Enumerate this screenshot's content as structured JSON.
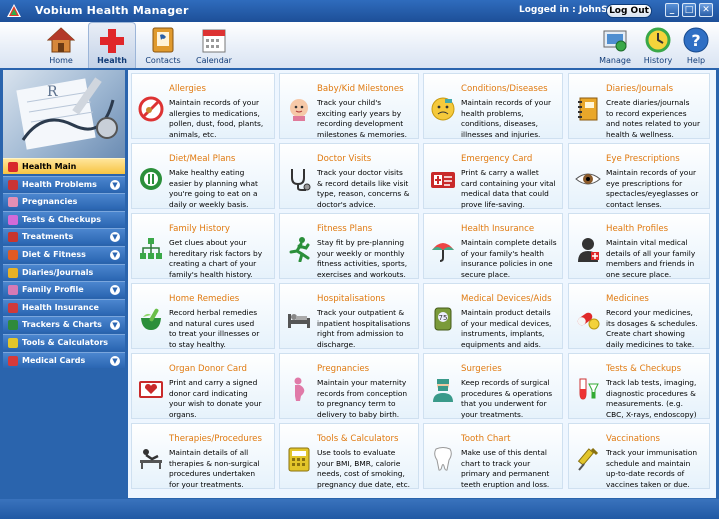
{
  "window": {
    "title": "Vobium Health Manager",
    "logged_in": "Logged in : JohnS",
    "logout": "Log Out",
    "min": "_",
    "max": "□",
    "close": "✕"
  },
  "toolbar": {
    "left": [
      {
        "label": "Home",
        "icon": "home-icon"
      },
      {
        "label": "Health",
        "icon": "health-cross-icon"
      },
      {
        "label": "Contacts",
        "icon": "contacts-book-icon"
      },
      {
        "label": "Calendar",
        "icon": "calendar-icon"
      }
    ],
    "right": [
      {
        "label": "Manage",
        "icon": "manage-icon"
      },
      {
        "label": "History",
        "icon": "history-icon"
      },
      {
        "label": "Help",
        "icon": "help-icon"
      }
    ]
  },
  "sidebar": {
    "items": [
      {
        "label": "Health Main",
        "color": "#d8282c",
        "chevron": false,
        "active": true
      },
      {
        "label": "Health Problems",
        "color": "#c93434",
        "chevron": true,
        "active": false
      },
      {
        "label": "Pregnancies",
        "color": "#e38fb4",
        "chevron": false,
        "active": false
      },
      {
        "label": "Tests & Checkups",
        "color": "#d26ad8",
        "chevron": false,
        "active": false
      },
      {
        "label": "Treatments",
        "color": "#c8352e",
        "chevron": true,
        "active": false
      },
      {
        "label": "Diet & Fitness",
        "color": "#e05a24",
        "chevron": true,
        "active": false
      },
      {
        "label": "Diaries/Journals",
        "color": "#e8b126",
        "chevron": false,
        "active": false
      },
      {
        "label": "Family Profile",
        "color": "#d77ab5",
        "chevron": true,
        "active": false
      },
      {
        "label": "Health Insurance",
        "color": "#cf3a3a",
        "chevron": false,
        "active": false
      },
      {
        "label": "Trackers & Charts",
        "color": "#2f8a3a",
        "chevron": true,
        "active": false
      },
      {
        "label": "Tools & Calculators",
        "color": "#e2c52a",
        "chevron": false,
        "active": false
      },
      {
        "label": "Medical Cards",
        "color": "#d63a3a",
        "chevron": true,
        "active": false
      }
    ]
  },
  "tiles": [
    {
      "title": "Allergies",
      "desc": "Maintain records of your\nallergies to medications,\npollen, dust, food, plants,\nanimals, etc.",
      "icon": "no-allergy-icon"
    },
    {
      "title": "Baby/Kid Milestones",
      "desc": "Track your child's\nexciting early years by\nrecording development\nmilestones & memories.",
      "icon": "baby-icon"
    },
    {
      "title": "Conditions/Diseases",
      "desc": "Maintain records of your\nhealth problems,\nconditions, diseases,\nillnesses and injuries.",
      "icon": "sick-face-icon"
    },
    {
      "title": "Diaries/Journals",
      "desc": "Create diaries/journals\nto record experiences\nand notes related to your\nhealth & wellness.",
      "icon": "journal-icon"
    },
    {
      "title": "Diet/Meal Plans",
      "desc": "Make healthy eating\neasier by planning what\nyou're going to eat on a\ndaily or weekly basis.",
      "icon": "meal-plate-icon"
    },
    {
      "title": "Doctor Visits",
      "desc": "Track your doctor visits\n& record details like visit\ntype, reason, concerns &\ndoctor's advice.",
      "icon": "stethoscope-icon"
    },
    {
      "title": "Emergency Card",
      "desc": "Print & carry a wallet\ncard containing your vital\nmedical data that could\nprove life-saving.",
      "icon": "emergency-card-icon"
    },
    {
      "title": "Eye Prescriptions",
      "desc": "Maintain records of your\neye prescriptions for\nspectacles/eyeglasses or\ncontact lenses.",
      "icon": "eye-icon"
    },
    {
      "title": "Family History",
      "desc": "Get clues about your\nhereditary risk factors by\ncreating a chart of your\nfamily's health history.",
      "icon": "family-tree-icon"
    },
    {
      "title": "Fitness Plans",
      "desc": "Stay fit by pre-planning\nyour weekly or monthly\nfitness activities, sports,\nexercises and workouts.",
      "icon": "runner-icon"
    },
    {
      "title": "Health Insurance",
      "desc": "Maintain complete details\nof your family's health\ninsurance policies in one\nsecure place.",
      "icon": "umbrella-icon"
    },
    {
      "title": "Health Profiles",
      "desc": "Maintain vital medical\ndetails of all your family\nmembers and friends in\none secure place.",
      "icon": "profile-icon"
    },
    {
      "title": "Home Remedies",
      "desc": "Record herbal remedies\nand natural cures used\nto treat your illnesses or\nto stay healthy.",
      "icon": "mortar-pestle-icon"
    },
    {
      "title": "Hospitalisations",
      "desc": "Track your outpatient &\ninpatient hospitalisations\nright from admission to\ndischarge.",
      "icon": "hospital-bed-icon"
    },
    {
      "title": "Medical Devices/Aids",
      "desc": "Maintain product details\nof your medical devices,\ninstruments, implants,\nequipments and aids.",
      "icon": "medical-device-icon"
    },
    {
      "title": "Medicines",
      "desc": "Record your medicines,\nits dosages & schedules.\nCreate chart showing\ndaily medicines to take.",
      "icon": "pills-icon"
    },
    {
      "title": "Organ Donor Card",
      "desc": "Print and carry a signed\ndonor card indicating\nyour wish to donate your\norgans.",
      "icon": "donor-card-icon"
    },
    {
      "title": "Pregnancies",
      "desc": "Maintain your maternity\nrecords from conception\nto pregnancy term to\ndelivery to baby birth.",
      "icon": "pregnancy-icon"
    },
    {
      "title": "Surgeries",
      "desc": "Keep records of surgical\nprocedures & operations\nthat you underwent for\nyour treatments.",
      "icon": "surgeon-icon"
    },
    {
      "title": "Tests & Checkups",
      "desc": "Track lab tests, imaging,\ndiagnostic procedures &\nmeasurements. (e.g.\nCBC, X-rays, endoscopy)",
      "icon": "test-tube-icon"
    },
    {
      "title": "Therapies/Procedures",
      "desc": "Maintain details of all\ntherapies & non-surgical\nprocedures undertaken\nfor your treatments.",
      "icon": "therapy-icon"
    },
    {
      "title": "Tools & Calculators",
      "desc": "Use tools to evaluate\nyour BMI, BMR, calorie\nneeds, cost of smoking,\npregnancy due date, etc.",
      "icon": "calculator-icon"
    },
    {
      "title": "Tooth Chart",
      "desc": "Make use of this dental\nchart to track your\nprimary and permanent\nteeth eruption and loss.",
      "icon": "tooth-icon"
    },
    {
      "title": "Vaccinations",
      "desc": "Track your immunisation\nschedule and maintain\nup-to-date records of\nvaccines taken or due.",
      "icon": "syringe-icon"
    }
  ]
}
